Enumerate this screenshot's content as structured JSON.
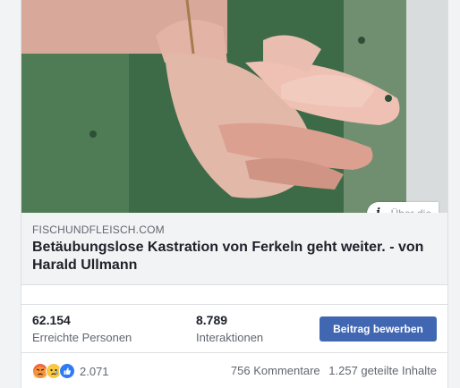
{
  "link_preview": {
    "domain": "FISCHUNDFLEISCH.COM",
    "headline": "Betäubungslose Kastration von Ferkeln geht weiter. - von Harald Ullmann",
    "about_label": "Über die"
  },
  "insights": {
    "reach_value": "62.154",
    "reach_label": "Erreichte Personen",
    "interactions_value": "8.789",
    "interactions_label": "Interaktionen",
    "promote_label": "Beitrag bewerben"
  },
  "footer": {
    "reactions": [
      "angry-reaction-icon",
      "sad-reaction-icon",
      "like-reaction-icon"
    ],
    "reaction_count": "2.071",
    "comments": "756 Kommentare",
    "shares": "1.257 geteilte Inhalte"
  },
  "colors": {
    "accent": "#4267b2",
    "meta_background": "#f2f3f5",
    "angry": "#f0683a",
    "sad": "#f7c844",
    "like": "#2f7bf5"
  }
}
